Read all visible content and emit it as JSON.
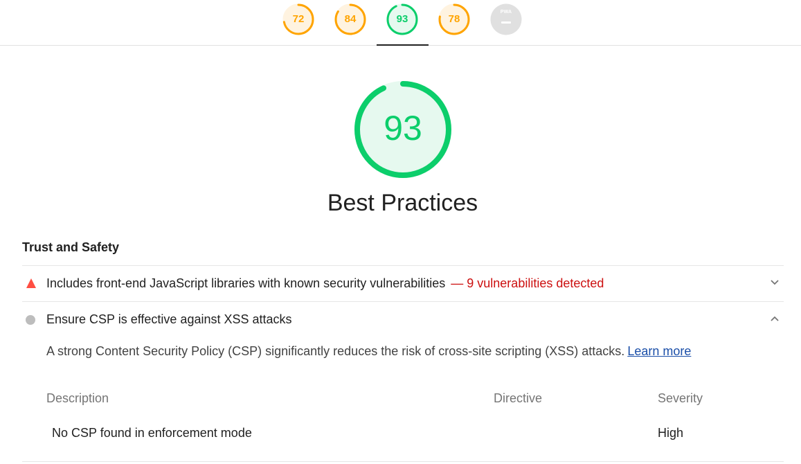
{
  "nav": {
    "scores": [
      {
        "label": "72",
        "value": 72,
        "color": "#ffa400",
        "track": "#fff3e0",
        "status": "average"
      },
      {
        "label": "84",
        "value": 84,
        "color": "#ffa400",
        "track": "#fff3e0",
        "status": "average"
      },
      {
        "label": "93",
        "value": 93,
        "color": "#0cce6b",
        "track": "#e6f9ef",
        "status": "pass",
        "active": true
      },
      {
        "label": "78",
        "value": 78,
        "color": "#ffa400",
        "track": "#fff3e0",
        "status": "average"
      }
    ],
    "pwa": {
      "label": "PWA",
      "badge_color": "#e0e0e0"
    }
  },
  "category": {
    "score_label": "93",
    "score_value": 93,
    "title": "Best Practices",
    "color": "#0cce6b",
    "track": "#e6f9ef"
  },
  "group": {
    "title": "Trust and Safety",
    "audits": [
      {
        "title": "Includes front-end JavaScript libraries with known security vulnerabilities",
        "display_value": "— 9 vulnerabilities detected",
        "status": "fail",
        "expanded": false,
        "icon": "triangle-icon",
        "status_color": "#ff4e42"
      },
      {
        "title": "Ensure CSP is effective against XSS attacks",
        "status": "informative",
        "expanded": true,
        "icon": "circle-icon",
        "status_color": "#bdbdbd",
        "description": "A strong Content Security Policy (CSP) significantly reduces the risk of cross-site scripting (XSS) attacks.",
        "learn_more": "Learn more",
        "table": {
          "headers": [
            "Description",
            "Directive",
            "Severity"
          ],
          "rows": [
            [
              "No CSP found in enforcement mode",
              "",
              "High"
            ]
          ]
        }
      }
    ]
  }
}
